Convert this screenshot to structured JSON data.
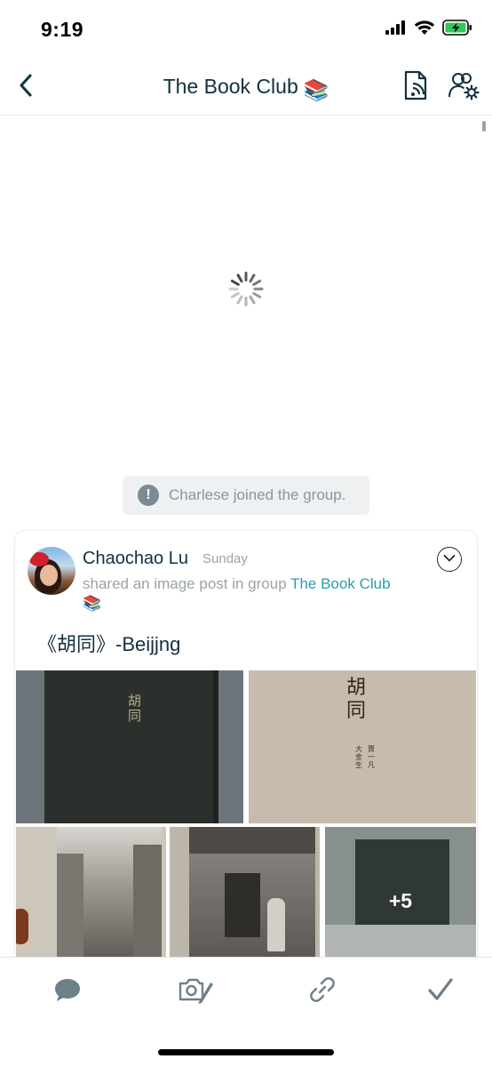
{
  "status_bar": {
    "time": "9:19",
    "icons": [
      "cellular-signal-icon",
      "wifi-icon",
      "battery-charging-icon"
    ]
  },
  "nav": {
    "back_icon": "chevron-left-icon",
    "title": "The Book Club",
    "title_emoji": "📚",
    "right_icons": [
      "document-feed-icon",
      "group-settings-icon"
    ]
  },
  "system_message": {
    "icon": "info-icon",
    "icon_glyph": "!",
    "text": "Charlese joined the group."
  },
  "post": {
    "author": "Chaochao Lu",
    "time": "Sunday",
    "meta_prefix": "shared an image post in group ",
    "group_name": "The Book Club",
    "group_emoji": "📚",
    "menu_icon": "chevron-down-icon",
    "text": "《胡同》-Beijjng",
    "photos": [
      {
        "name": "book-cover-photo",
        "chars": "胡同"
      },
      {
        "name": "title-page-photo",
        "chars": "胡同",
        "small_left": "大金生",
        "small_right": "賈一凡"
      },
      {
        "name": "alley-photo"
      },
      {
        "name": "courtyard-door-photo"
      },
      {
        "name": "snow-gate-photo",
        "more_count": "+5"
      }
    ]
  },
  "toolbar": {
    "items": [
      "chat-bubble-icon",
      "camera-edit-icon",
      "link-icon",
      "checkmark-icon"
    ]
  },
  "colors": {
    "accent": "#2a9bb0",
    "title": "#12303f",
    "muted": "#9aa3a8",
    "icon": "#6c8088"
  }
}
